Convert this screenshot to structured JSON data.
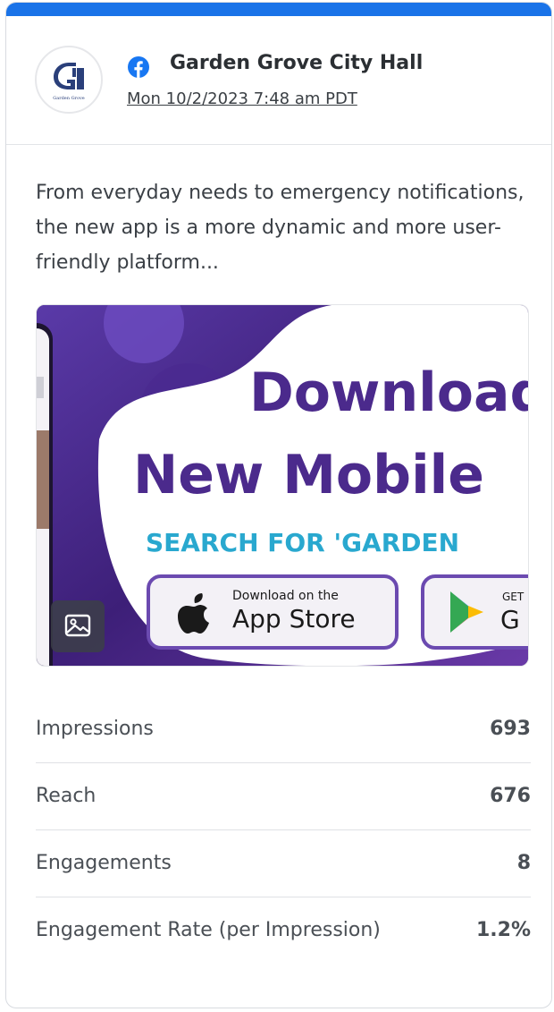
{
  "post": {
    "account_name": "Garden Grove City Hall",
    "date": "Mon 10/2/2023 7:48 am PDT",
    "text": "From everyday needs to emergency notifications, the new app is a more dynamic and more user-friendly platform...",
    "avatar_logo_text": "Garden Grove",
    "network_icon": "facebook-icon",
    "image": {
      "headline_line1": "Download",
      "headline_line2": "New Mobile",
      "subline": "SEARCH FOR 'GARDEN",
      "appstore_small": "Download on the",
      "appstore_big": "App Store",
      "play_small": "GET",
      "play_big": "G",
      "overlay_icon": "image-icon"
    }
  },
  "metrics": [
    {
      "label": "Impressions",
      "value": "693"
    },
    {
      "label": "Reach",
      "value": "676"
    },
    {
      "label": "Engagements",
      "value": "8"
    },
    {
      "label": "Engagement Rate (per Impression)",
      "value": "1.2%"
    }
  ],
  "colors": {
    "accent_bar": "#1a73e8",
    "facebook": "#1877f2",
    "banner_purple": "#4b2a8c",
    "banner_teal": "#29a8cf"
  }
}
